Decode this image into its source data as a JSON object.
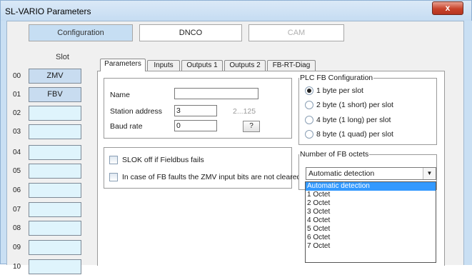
{
  "window": {
    "title": "SL-VARIO Parameters",
    "close_glyph": "x"
  },
  "top_tabs": [
    {
      "label": "Configuration"
    },
    {
      "label": "DNCO"
    },
    {
      "label": "CAM"
    }
  ],
  "slots": {
    "header": "Slot",
    "items": [
      {
        "num": "00",
        "value": "ZMV"
      },
      {
        "num": "01",
        "value": "FBV"
      },
      {
        "num": "02",
        "value": ""
      },
      {
        "num": "03",
        "value": ""
      },
      {
        "num": "04",
        "value": ""
      },
      {
        "num": "05",
        "value": ""
      },
      {
        "num": "06",
        "value": ""
      },
      {
        "num": "07",
        "value": ""
      },
      {
        "num": "08",
        "value": ""
      },
      {
        "num": "09",
        "value": ""
      },
      {
        "num": "10",
        "value": ""
      }
    ]
  },
  "sub_tabs": [
    {
      "label": "Parameters"
    },
    {
      "label": "Inputs"
    },
    {
      "label": "Outputs 1"
    },
    {
      "label": "Outputs 2"
    },
    {
      "label": "FB-RT-Diag"
    }
  ],
  "params": {
    "name_label": "Name",
    "name_value": "",
    "station_label": "Station address",
    "station_value": "3",
    "station_range": "2...125",
    "baud_label": "Baud rate",
    "baud_value": "0",
    "help_label": "?"
  },
  "options": {
    "slok_label": "SLOK off if Fieldbus fails",
    "zmv_label": "In case of FB faults the ZMV input bits are not cleared"
  },
  "plc_fb": {
    "legend": "PLC FB Configuration",
    "options": [
      {
        "label": "1 byte per slot"
      },
      {
        "label": "2 byte (1 short) per slot"
      },
      {
        "label": "4 byte (1 long) per slot"
      },
      {
        "label": "8 byte (1 quad) per slot"
      }
    ]
  },
  "fb_octets": {
    "legend": "Number of FB octets",
    "selected": "Automatic detection",
    "arrow_glyph": "▼",
    "list": [
      "Automatic detection",
      "1 Octet",
      "2 Octet",
      "3 Octet",
      "4 Octet",
      "5 Octet",
      "6 Octet",
      "7 Octet"
    ]
  },
  "colors": {
    "window_frame": "#c9dff3",
    "slot_filled": "#c8dcf0",
    "slot_empty": "#dff4fc",
    "selection": "#3399ff",
    "close_button": "#c8432b"
  }
}
